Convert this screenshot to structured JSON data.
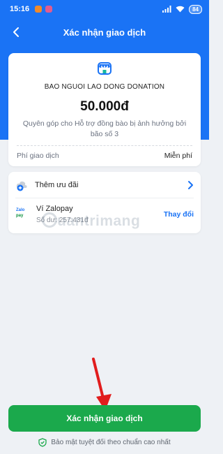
{
  "status_bar": {
    "time": "15:16",
    "battery": "84",
    "icons": [
      "app-notification-icon",
      "app-notification-icon",
      "signal-icon",
      "wifi-icon",
      "battery-icon"
    ]
  },
  "header": {
    "title": "Xác nhận giao dịch",
    "back_icon": "back-arrow-icon",
    "background_color": "#1a73f5"
  },
  "transaction": {
    "merchant_icon": "store-icon",
    "merchant_name": "BAO NGUOI LAO DONG DONATION",
    "amount": "50.000đ",
    "description": "Quyên góp cho Hỗ trợ đồng bào bị ảnh hưởng bởi bão số 3",
    "fee_label": "Phí giao dịch",
    "fee_value": "Miễn phí"
  },
  "payment": {
    "promo_icon": "cloud-plus-icon",
    "promo_label": "Thêm ưu đãi",
    "promo_chevron": "chevron-right-icon",
    "wallet_logo_top": "Zalo",
    "wallet_logo_bottom": "pay",
    "wallet_name": "Ví Zalopay",
    "wallet_balance": "Số dư: 257.431đ",
    "change_label": "Thay đổi"
  },
  "watermark": "uantrimang",
  "footer": {
    "confirm_label": "Xác nhận giao dịch",
    "confirm_color": "#1ba94c",
    "security_icon": "shield-check-icon",
    "security_note": "Bảo mật tuyệt đối theo chuẩn cao nhất"
  }
}
